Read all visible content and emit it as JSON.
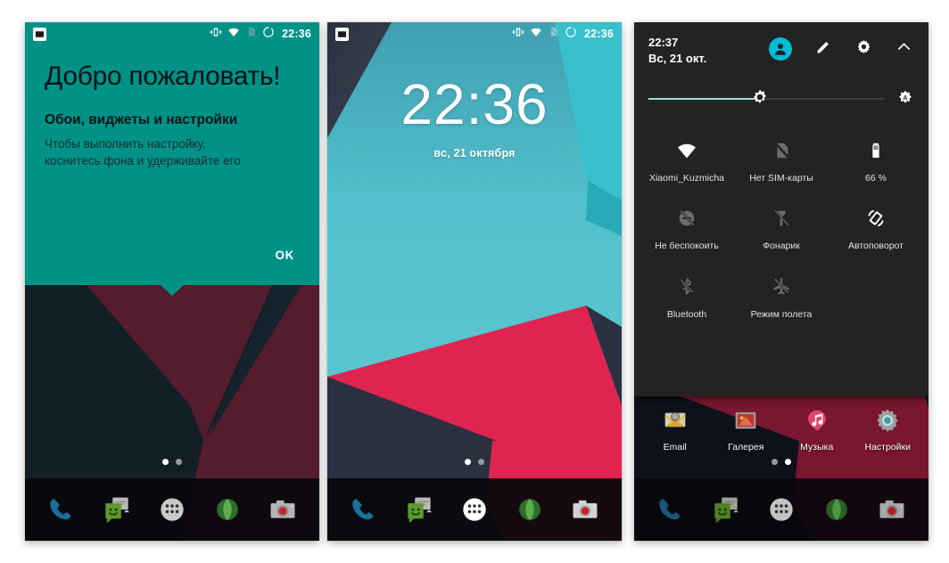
{
  "panels": [
    {
      "id": "welcome",
      "statusbar": {
        "notification_icon": "image-icon",
        "icons": [
          "vibrate-icon",
          "wifi-icon",
          "no-sim-icon",
          "sync-circle-icon"
        ],
        "time": "22:36"
      },
      "card": {
        "title": "Добро пожаловать!",
        "subtitle": "Обои, виджеты и настройки",
        "body": "Чтобы выполнить настройку,\nкоснитесь фона и удерживайте его",
        "ok_label": "OK",
        "background_color": "#009287"
      },
      "page_dots": {
        "count": 2,
        "active_index": 0
      }
    },
    {
      "id": "homescreen",
      "statusbar": {
        "notification_icon": "image-icon",
        "icons": [
          "vibrate-icon",
          "wifi-icon",
          "no-sim-icon",
          "sync-circle-icon"
        ],
        "time": "22:36"
      },
      "clock": {
        "time": "22:36",
        "date": "вс, 21 октября"
      },
      "page_dots": {
        "count": 2,
        "active_index": 0
      }
    },
    {
      "id": "quicksettings",
      "header": {
        "time": "22:37",
        "date": "Вс, 21 окт.",
        "icons": [
          "user-avatar-icon",
          "edit-pencil-icon",
          "gear-icon",
          "chevron-up-icon"
        ],
        "accent_color": "#00bcd4"
      },
      "brightness": {
        "label": "brightness-slider",
        "value_percent": 47,
        "auto_icon": "auto-brightness-icon",
        "fill_color": "#8fe2e8"
      },
      "tiles": [
        {
          "icon": "wifi-icon",
          "label": "Xiaomi_Kuzmicha",
          "enabled": true
        },
        {
          "icon": "no-sim-icon",
          "label": "Нет SIM-карты",
          "enabled": false
        },
        {
          "icon": "battery-icon",
          "label": "66 %",
          "enabled": true
        },
        {
          "icon": "do-not-disturb-icon",
          "label": "Не беспокоить",
          "enabled": false
        },
        {
          "icon": "flashlight-icon",
          "label": "Фонарик",
          "enabled": false
        },
        {
          "icon": "auto-rotate-icon",
          "label": "Автоповорот",
          "enabled": true
        },
        {
          "icon": "bluetooth-off-icon",
          "label": "Bluetooth",
          "enabled": false
        },
        {
          "icon": "airplane-off-icon",
          "label": "Режим полета",
          "enabled": false
        }
      ],
      "apps": [
        {
          "icon": "email-icon",
          "label": "Email"
        },
        {
          "icon": "gallery-icon",
          "label": "Галерея"
        },
        {
          "icon": "music-icon",
          "label": "Музыка"
        },
        {
          "icon": "settings-icon",
          "label": "Настройки"
        }
      ],
      "page_dots": {
        "count": 2,
        "active_index": 1
      }
    }
  ],
  "dock": {
    "items": [
      {
        "icon": "phone-icon",
        "label": "Телефон"
      },
      {
        "icon": "messaging-icon",
        "label": "SMS/MMS"
      },
      {
        "icon": "app-drawer-icon",
        "label": "Все приложения"
      },
      {
        "icon": "browser-icon",
        "label": "Браузер"
      },
      {
        "icon": "camera-icon",
        "label": "Камера"
      }
    ]
  },
  "colors": {
    "teal_card": "#009287",
    "wall_cyan": "#5ec8d0",
    "wall_red": "#d8254e",
    "wall_dark": "#2b303f",
    "wall_maroon": "#8a1b32",
    "shade_bg": "#232323",
    "accent": "#00bcd4"
  }
}
